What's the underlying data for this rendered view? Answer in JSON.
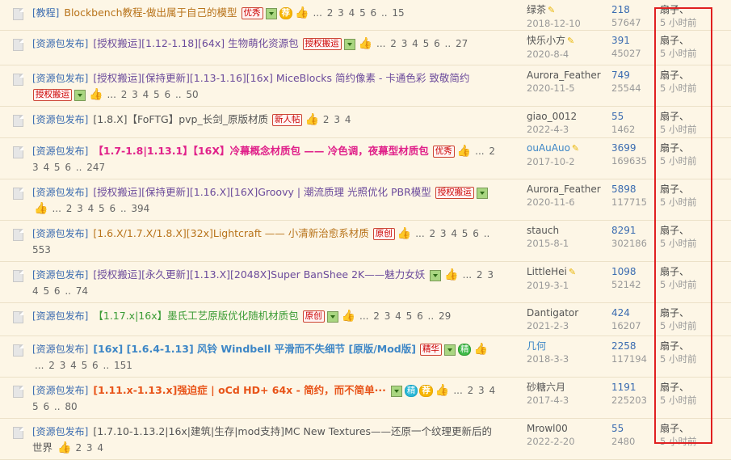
{
  "threads": [
    {
      "category": "[教程]",
      "title": "Blockbench教程-做出属于自己的模型",
      "style": "orange",
      "badges": [
        {
          "t": "优秀",
          "k": "box"
        },
        {
          "t": "img",
          "k": "img"
        },
        {
          "t": "荐",
          "k": "gold"
        }
      ],
      "thumb": true,
      "pages": "... 2 3 4 5 6 .. 15",
      "author": "绿茶",
      "author_pencil": true,
      "author_blue": false,
      "date": "2018-12-10",
      "replies": "218",
      "views": "57647",
      "last_user": "扇子、",
      "last_time": "5 小时前"
    },
    {
      "category": "[资源包发布]",
      "title": "[授权搬运][1.12-1.18][64x] 生物萌化资源包",
      "style": "purple",
      "badges": [
        {
          "t": "授权搬运",
          "k": "box"
        },
        {
          "t": "img",
          "k": "img"
        }
      ],
      "thumb": true,
      "pages": "... 2 3 4 5 6 .. 27",
      "author": "快乐小方",
      "author_pencil": true,
      "author_blue": false,
      "date": "2020-8-4",
      "replies": "391",
      "views": "45027",
      "last_user": "扇子、",
      "last_time": "5 小时前"
    },
    {
      "category": "[资源包发布]",
      "title": "[授权搬运][保持更新][1.13-1.16][16x] MiceBlocks 简约像素 - 卡通色彩 致敬简约",
      "style": "purple",
      "badges": [
        {
          "t": "授权搬运",
          "k": "box"
        },
        {
          "t": "img",
          "k": "img"
        }
      ],
      "thumb": true,
      "pages": "... 2 3 4 5 6 .. 50",
      "author": "Aurora_Feather",
      "author_pencil": false,
      "author_blue": false,
      "date": "2020-11-5",
      "replies": "749",
      "views": "25544",
      "last_user": "扇子、",
      "last_time": "5 小时前"
    },
    {
      "category": "[资源包发布]",
      "title": "[1.8.X]【FoFTG】pvp_长剑_原版材质",
      "style": "plain",
      "badges": [
        {
          "t": "新人帖",
          "k": "box"
        }
      ],
      "thumb": true,
      "pages": "2 3 4",
      "author": "giao_0012",
      "author_pencil": false,
      "author_blue": false,
      "date": "2022-4-3",
      "replies": "55",
      "views": "1462",
      "last_user": "扇子、",
      "last_time": "5 小时前"
    },
    {
      "category": "[资源包发布]",
      "title": "【1.7-1.8|1.13.1】【16X】冷幕概念材质包 —— 冷色调，夜幕型材质包",
      "style": "pinkbold",
      "badges": [
        {
          "t": "优秀",
          "k": "box"
        }
      ],
      "thumb": true,
      "pages": "... 2 3 4 5 6 .. 247",
      "author": "ouAuAuo",
      "author_pencil": true,
      "author_blue": true,
      "date": "2017-10-2",
      "replies": "3699",
      "views": "169635",
      "last_user": "扇子、",
      "last_time": "5 小时前"
    },
    {
      "category": "[资源包发布]",
      "title": "[授权搬运][保持更新][1.16.X][16X]Groovy | 潮流质理 光照优化 PBR模型",
      "style": "purple",
      "badges": [
        {
          "t": "授权搬运",
          "k": "box"
        },
        {
          "t": "img",
          "k": "img"
        }
      ],
      "thumb": true,
      "pages": "... 2 3 4 5 6 .. 394",
      "author": "Aurora_Feather",
      "author_pencil": false,
      "author_blue": false,
      "date": "2020-11-6",
      "replies": "5898",
      "views": "117715",
      "last_user": "扇子、",
      "last_time": "5 小时前"
    },
    {
      "category": "[资源包发布]",
      "title": "[1.6.X/1.7.X/1.8.X][32x]Lightcraft —— 小清新治愈系材质",
      "style": "orange",
      "badges": [
        {
          "t": "原创",
          "k": "box"
        }
      ],
      "thumb": true,
      "pages": "... 2 3 4 5 6 .. 553",
      "author": "stauch",
      "author_pencil": false,
      "author_blue": false,
      "date": "2015-8-1",
      "replies": "8291",
      "views": "302186",
      "last_user": "扇子、",
      "last_time": "5 小时前"
    },
    {
      "category": "[资源包发布]",
      "title": "[授权搬运][永久更新][1.13.X][2048X]Super BanShee 2K——魅力女妖",
      "style": "purple",
      "badges": [
        {
          "t": "img",
          "k": "img"
        }
      ],
      "thumb": true,
      "pages": "... 2 3 4 5 6 .. 74",
      "author": "LittleHei",
      "author_pencil": true,
      "author_blue": false,
      "date": "2019-3-1",
      "replies": "1098",
      "views": "52142",
      "last_user": "扇子、",
      "last_time": "5 小时前"
    },
    {
      "category": "[资源包发布]",
      "title": "【1.17.x|16x】墨氏工艺原版优化随机材质包",
      "style": "green",
      "badges": [
        {
          "t": "原创",
          "k": "box"
        },
        {
          "t": "img",
          "k": "img"
        }
      ],
      "thumb": true,
      "pages": "... 2 3 4 5 6 .. 29",
      "author": "Dantigator",
      "author_pencil": false,
      "author_blue": false,
      "date": "2021-2-3",
      "replies": "424",
      "views": "16207",
      "last_user": "扇子、",
      "last_time": "5 小时前"
    },
    {
      "category": "[资源包发布]",
      "title": "[16x] [1.6.4-1.13] 风铃 Windbell 平滑而不失细节 [原版/Mod版]",
      "style": "blue",
      "badges": [
        {
          "t": "精华",
          "k": "box"
        },
        {
          "t": "img",
          "k": "img"
        },
        {
          "t": "精",
          "k": "green"
        }
      ],
      "thumb": true,
      "pages": "... 2 3 4 5 6 .. 151",
      "author": "几何",
      "author_pencil": false,
      "author_blue": true,
      "date": "2018-3-3",
      "replies": "2258",
      "views": "117194",
      "last_user": "扇子、",
      "last_time": "5 小时前"
    },
    {
      "category": "[资源包发布]",
      "title": "[1.11.x-1.13.x]强迫症 | oCd HD+ 64x - 简约，而不简单···",
      "style": "redbold",
      "badges": [
        {
          "t": "img",
          "k": "img"
        },
        {
          "t": "精",
          "k": "cyan"
        },
        {
          "t": "荐",
          "k": "gold"
        }
      ],
      "thumb": true,
      "pages": "... 2 3 4 5 6 .. 80",
      "author": "砂糖六月",
      "author_pencil": false,
      "author_blue": false,
      "date": "2017-4-3",
      "replies": "1191",
      "views": "225203",
      "last_user": "扇子、",
      "last_time": "5 小时前"
    },
    {
      "category": "[资源包发布]",
      "title": "[1.7.10-1.13.2|16x|建筑|生存|mod支持]MC New Textures——还原一个纹理更新后的世界",
      "style": "plain",
      "badges": [],
      "thumb": true,
      "pages": "2 3 4",
      "author": "Mrowl00",
      "author_pencil": false,
      "author_blue": false,
      "date": "2022-2-20",
      "replies": "55",
      "views": "2480",
      "last_user": "扇子、",
      "last_time": "5 小时前"
    }
  ]
}
